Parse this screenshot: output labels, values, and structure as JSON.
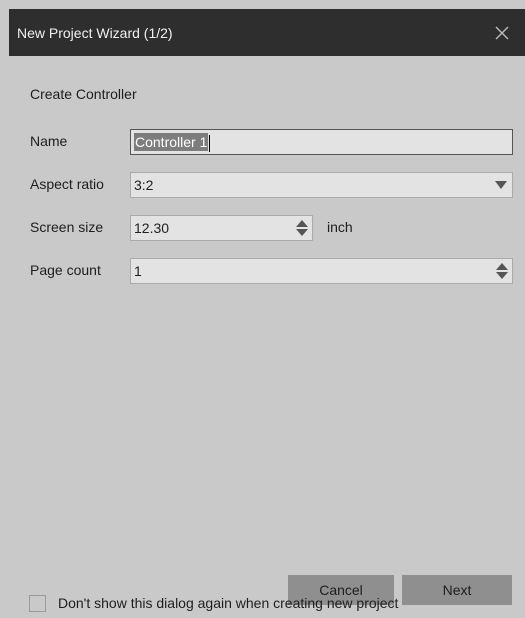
{
  "window": {
    "title": "New Project Wizard (1/2)",
    "close_icon": "close-icon"
  },
  "section_title": "Create Controller",
  "form": {
    "name": {
      "label": "Name",
      "value": "Controller 1"
    },
    "aspect_ratio": {
      "label": "Aspect ratio",
      "value": "3:2"
    },
    "screen_size": {
      "label": "Screen size",
      "value": "12.30",
      "unit": "inch"
    },
    "page_count": {
      "label": "Page count",
      "value": "1"
    }
  },
  "buttons": {
    "cancel": "Cancel",
    "next": "Next"
  },
  "dont_show": {
    "label": "Don't show this dialog again when creating new project",
    "checked": false
  }
}
